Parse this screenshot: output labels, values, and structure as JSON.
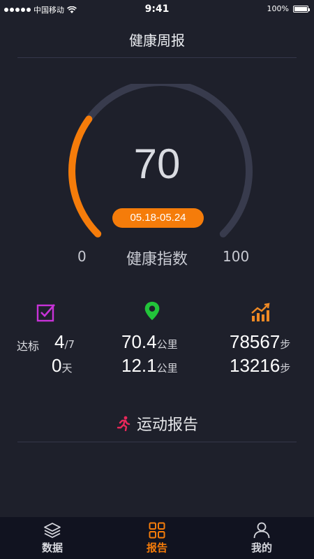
{
  "status_bar": {
    "carrier": "中国移动",
    "time": "9:41",
    "battery": "100%"
  },
  "header": {
    "title": "健康周报"
  },
  "gauge": {
    "score": "70",
    "score_fraction": 0.7,
    "date_range": "05.18-05.24",
    "min": "0",
    "max": "100",
    "label": "健康指数",
    "colors": {
      "active": "#f57c0a",
      "track": "#383b4d"
    }
  },
  "stats": {
    "target": {
      "icon": "check-square-icon",
      "color": "#c832d8",
      "label": "达标",
      "value": "4",
      "suffix": "/7",
      "days_value": "0",
      "days_unit": "天"
    },
    "distance": {
      "icon": "location-pin-icon",
      "color": "#22c43a",
      "value1": "70.4",
      "unit1": "公里",
      "value2": "12.1",
      "unit2": "公里"
    },
    "steps": {
      "icon": "trend-chart-icon",
      "color": "#f08a24",
      "value1": "78567",
      "unit1": "步",
      "value2": "13216",
      "unit2": "步"
    }
  },
  "report": {
    "icon": "running-person-icon",
    "icon_color": "#e8285a",
    "title": "运动报告"
  },
  "tab_bar": {
    "active_color": "#f57c0a",
    "tabs": [
      {
        "label": "数据",
        "icon": "layers-icon"
      },
      {
        "label": "报告",
        "icon": "grid-icon"
      },
      {
        "label": "我的",
        "icon": "user-icon"
      }
    ]
  }
}
